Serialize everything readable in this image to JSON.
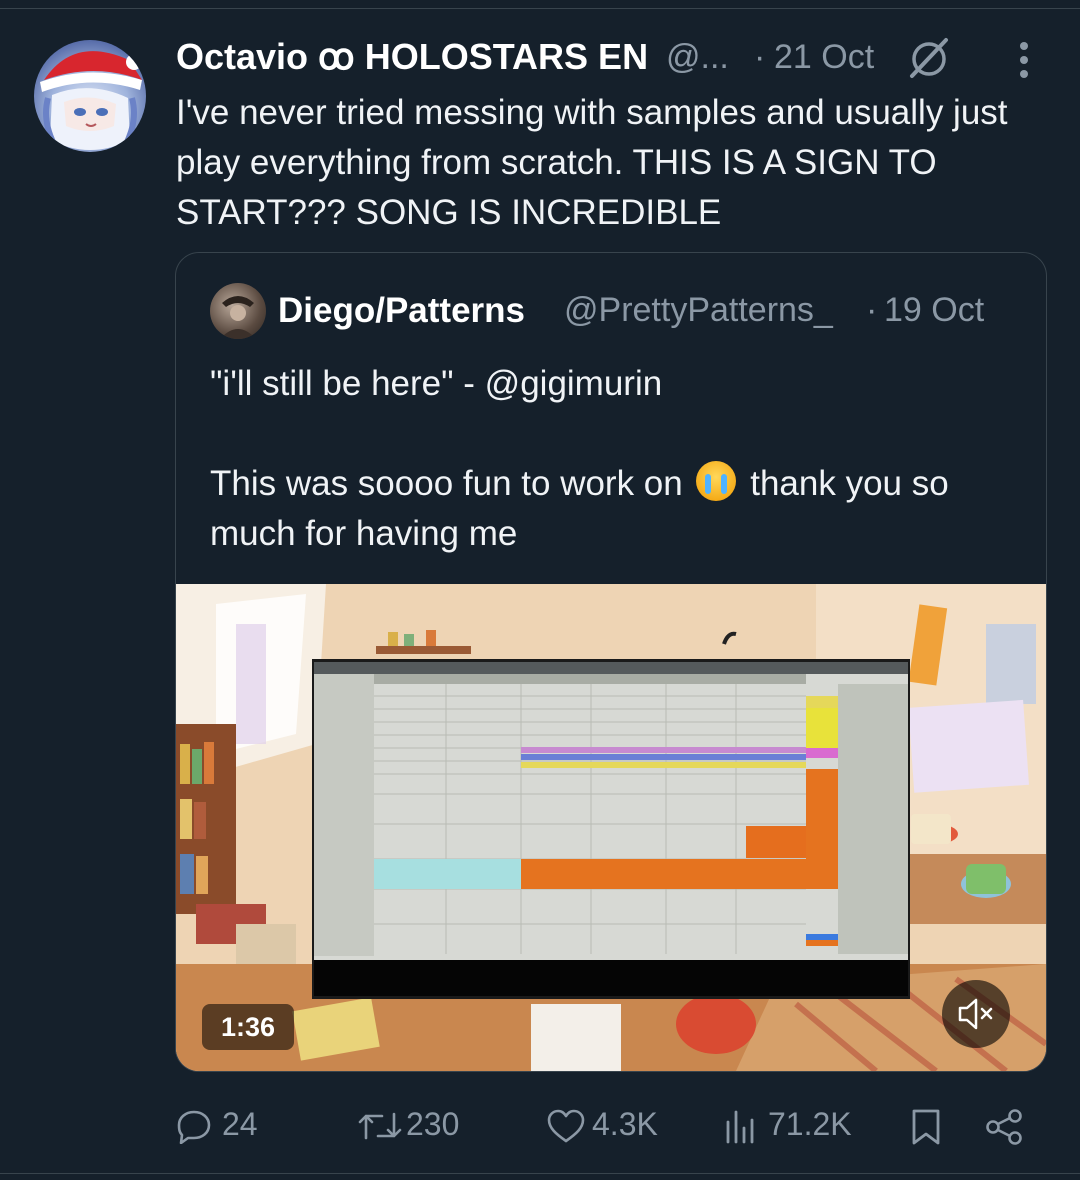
{
  "post": {
    "author_name": "Octavio ꝏ HOLOSTARS EN",
    "author_handle": "@...",
    "separator": "·",
    "date": "21 Oct",
    "text": "I've never tried messing with samples and usually just play everything from scratch. THIS IS A SIGN TO START??? SONG IS INCREDIBLE"
  },
  "quote": {
    "author_name": "Diego/Patterns",
    "author_handle": "@PrettyPatterns_",
    "separator": "·",
    "date": "19 Oct",
    "line1": "\"i'll still be here\" - @gigimurin",
    "line2_before_emoji": "This was soooo fun to work on",
    "emoji": "loudly-crying-face",
    "line2_after_emoji": "thank you so much for having me",
    "video": {
      "duration": "1:36",
      "muted": true
    }
  },
  "actions": {
    "replies": "24",
    "reposts": "230",
    "likes": "4.3K",
    "views": "71.2K"
  },
  "icons": {
    "grok": "grok-icon",
    "more": "more-vertical-icon",
    "reply": "reply-icon",
    "repost": "repost-icon",
    "like": "heart-icon",
    "views": "views-icon",
    "bookmark": "bookmark-icon",
    "share": "share-icon",
    "mute": "speaker-muted-icon"
  },
  "colors": {
    "background": "#15202b",
    "text": "#f0f3f6",
    "secondary_text": "#8b98a5",
    "border": "#38444d"
  }
}
